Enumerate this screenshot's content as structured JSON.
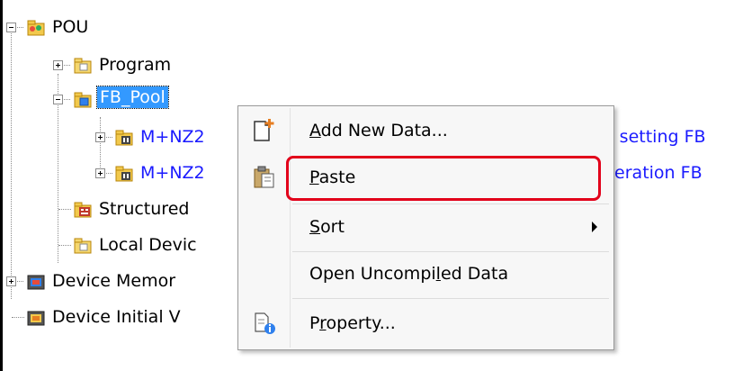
{
  "tree": {
    "pou": {
      "label": "POU"
    },
    "program": {
      "label": "Program"
    },
    "fb_pool": {
      "label": "FB_Pool"
    },
    "fb_item_1": {
      "label": "M+NZ2",
      "suffix": "a setting FB"
    },
    "fb_item_2": {
      "label": "M+NZ2",
      "suffix": "peration FB"
    },
    "structured": {
      "label": "Structured"
    },
    "local_device": {
      "label": "Local Devic"
    },
    "device_memory": {
      "label": "Device Memor"
    },
    "device_initial": {
      "label": "Device Initial V"
    }
  },
  "context_menu": {
    "add_new_data": {
      "before": "",
      "mnemonic": "A",
      "after": "dd New Data..."
    },
    "paste": {
      "before": "",
      "mnemonic": "P",
      "after": "aste"
    },
    "sort": {
      "before": "",
      "mnemonic": "S",
      "after": "ort"
    },
    "open_uncompiled": {
      "before": "Open Uncompi",
      "mnemonic": "l",
      "after": "ed Data"
    },
    "property": {
      "before": "P",
      "mnemonic": "r",
      "after": "operty..."
    }
  },
  "colors": {
    "selection": "#3399ff",
    "highlight_box": "#e2001a",
    "link_text": "#1a1aff"
  }
}
